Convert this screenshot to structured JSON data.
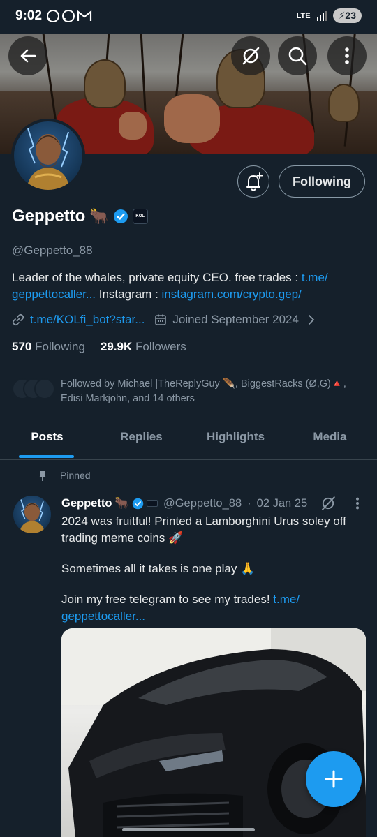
{
  "status_bar": {
    "time": "9:02",
    "network": "LTE",
    "battery": "23",
    "icons": [
      "whatsapp-icon",
      "whatsapp-icon",
      "gmail-icon",
      "signal-icon",
      "battery-charging-icon"
    ]
  },
  "header": {
    "back_icon": "arrow-left-icon",
    "grok_icon": "grok-icon",
    "search_icon": "search-icon",
    "more_icon": "more-vertical-icon"
  },
  "profile": {
    "display_name": "Geppetto",
    "emoji": "🐂",
    "verified": true,
    "affiliate_badge": "KOL",
    "handle": "@Geppetto_88",
    "bio_text_1": "Leader of the whales, private equity CEO. free trades : ",
    "bio_link_1": "t.me/ geppettocaller...",
    "bio_text_2": " Instagram : ",
    "bio_link_2": "instagram.com/crypto.gep/",
    "website": "t.me/KOLfi_bot?star...",
    "joined": "Joined September 2024",
    "following_count": "570",
    "following_label": "Following",
    "followers_count": "29.9K",
    "followers_label": "Followers",
    "followed_by": "Followed by Michael |TheReplyGuy 🪶, BiggestRacks (Ø,G)🔺, Edisi Markjohn, and 14 others"
  },
  "actions": {
    "follow_label": "Following",
    "notify_icon": "bell-plus-icon"
  },
  "tabs": [
    {
      "label": "Posts",
      "active": true
    },
    {
      "label": "Replies",
      "active": false
    },
    {
      "label": "Highlights",
      "active": false
    },
    {
      "label": "Media",
      "active": false
    }
  ],
  "post": {
    "pinned_label": "Pinned",
    "author": "Geppetto",
    "emoji": "🐂",
    "handle": "@Geppetto_88",
    "date": "02 Jan 25",
    "line_1": "2024 was fruitful! Printed a Lamborghini Urus soley off trading meme coins 🚀",
    "line_2": "Sometimes all it takes is one play 🙏",
    "line_3": "Join my free telegram to see my trades! ",
    "link": "t.me/ geppettocaller...",
    "image_alt": "black Lamborghini Urus"
  },
  "fab": {
    "icon": "plus-icon"
  },
  "colors": {
    "background": "#15202b",
    "accent": "#1d9bf0",
    "text": "#e7e9ea",
    "muted": "#8b98a5",
    "border": "#38444d"
  }
}
